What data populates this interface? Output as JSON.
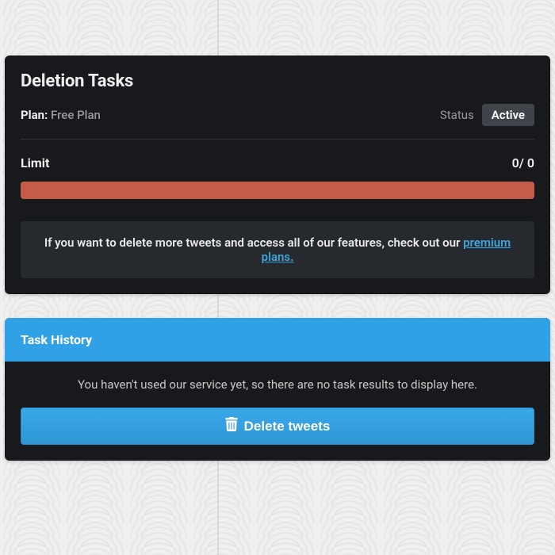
{
  "deletion": {
    "title": "Deletion Tasks",
    "plan_label": "Plan:",
    "plan_value": "Free Plan",
    "status_label": "Status",
    "status_value": "Active",
    "limit_label": "Limit",
    "limit_used": "0",
    "limit_sep": "/ ",
    "limit_total": "0",
    "progress_percent": 100,
    "progress_color": "#c45c49",
    "upsell_prefix": "If you want to delete more tweets and access all of our features, check out our ",
    "upsell_link_text": "premium plans."
  },
  "history": {
    "title": "Task History",
    "empty_text": "You haven't used our service yet, so there are no task results to display here.",
    "delete_button_label": "Delete tweets"
  }
}
